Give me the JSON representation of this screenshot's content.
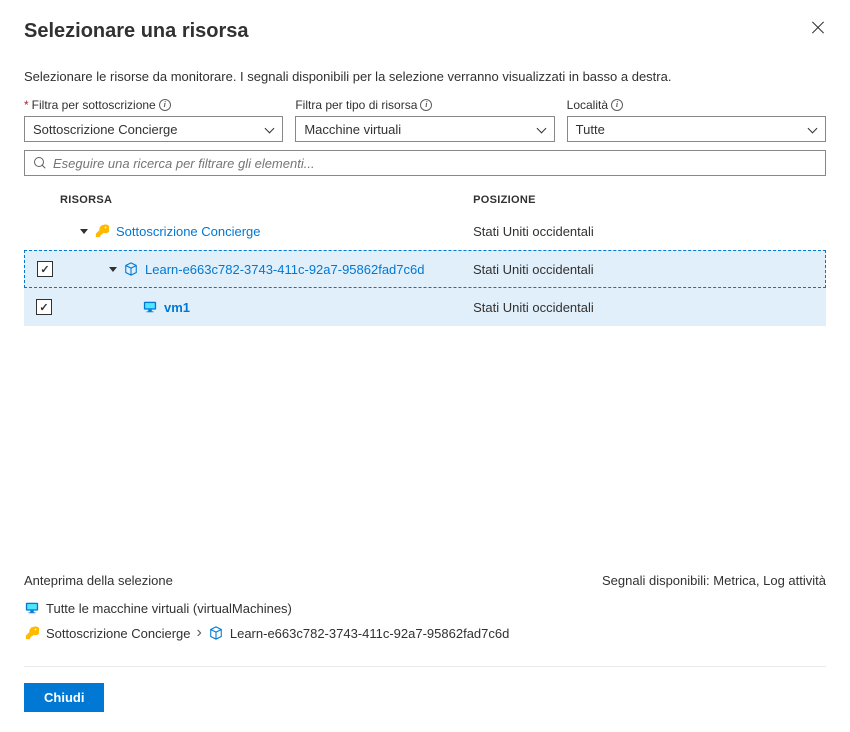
{
  "title": "Selezionare una risorsa",
  "description": "Selezionare le risorse da monitorare. I segnali disponibili per la selezione verranno visualizzati in basso a destra.",
  "filters": {
    "subscription": {
      "label": "Filtra per sottoscrizione",
      "value": "Sottoscrizione Concierge",
      "required": true
    },
    "resource_type": {
      "label": "Filtra per tipo di risorsa",
      "value": "Macchine virtuali"
    },
    "location": {
      "label": "Località",
      "value": "Tutte"
    }
  },
  "search": {
    "placeholder": "Eseguire una ricerca per filtrare gli elementi..."
  },
  "columns": {
    "resource": "RISORSA",
    "location": "POSIZIONE"
  },
  "tree": {
    "subscription": {
      "name": "Sottoscrizione Concierge",
      "location": "Stati Uniti occidentali"
    },
    "group": {
      "name": "Learn-e663c782-3743-411c-92a7-95862fad7c6d",
      "location": "Stati Uniti occidentali",
      "checked": true
    },
    "vm": {
      "name": "vm1",
      "location": "Stati Uniti occidentali",
      "checked": true
    }
  },
  "preview": {
    "label": "Anteprima della selezione",
    "signals": "Segnali disponibili: Metrica, Log attività",
    "all_vms": "Tutte le macchine virtuali (virtualMachines)",
    "subscription": "Sottoscrizione Concierge",
    "group": "Learn-e663c782-3743-411c-92a7-95862fad7c6d"
  },
  "buttons": {
    "close": "Chiudi"
  }
}
